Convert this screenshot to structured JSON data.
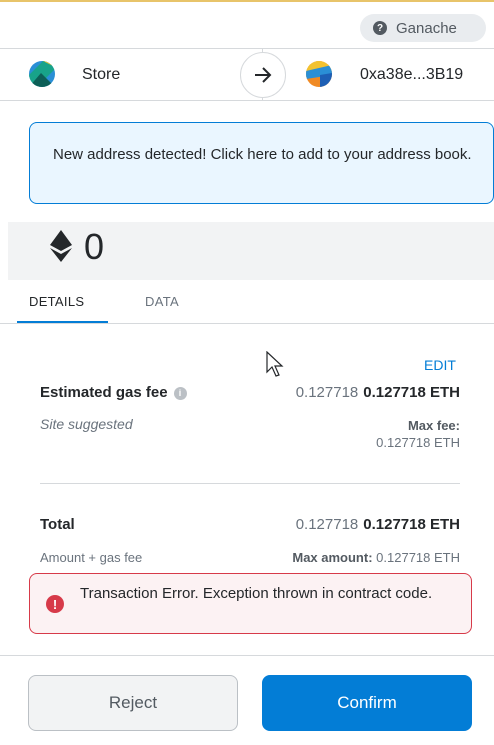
{
  "network": {
    "label": "Ganache",
    "icon": "question-circle-icon"
  },
  "sender": {
    "name": "Store",
    "avatar": "identicon"
  },
  "recipient": {
    "address": "0xa38e...3B19",
    "avatar": "identicon"
  },
  "notice": {
    "text": "New address detected! Click here to add to your address book."
  },
  "amount": {
    "value": "0",
    "icon": "ethereum-icon"
  },
  "tabs": [
    {
      "label": "DETAILS",
      "active": true
    },
    {
      "label": "DATA",
      "active": false
    }
  ],
  "gas": {
    "edit_label": "EDIT",
    "title": "Estimated gas fee",
    "secondary_value": "0.127718",
    "primary_value": "0.127718 ETH",
    "sub_label": "Site suggested",
    "max_fee_label": "Max fee:",
    "max_fee_value": "0.127718 ETH"
  },
  "total": {
    "title": "Total",
    "secondary_value": "0.127718",
    "primary_value": "0.127718 ETH",
    "sub_label": "Amount + gas fee",
    "max_amount_label": "Max amount:",
    "max_amount_value": "0.127718 ETH"
  },
  "error": {
    "text": "Transaction Error. Exception thrown in contract code.",
    "icon": "error-icon"
  },
  "buttons": {
    "reject": "Reject",
    "confirm": "Confirm"
  },
  "colors": {
    "accent": "#037dd6",
    "error": "#d73a49",
    "notice_bg": "#eaf6ff",
    "error_bg": "#fcf2f3"
  }
}
